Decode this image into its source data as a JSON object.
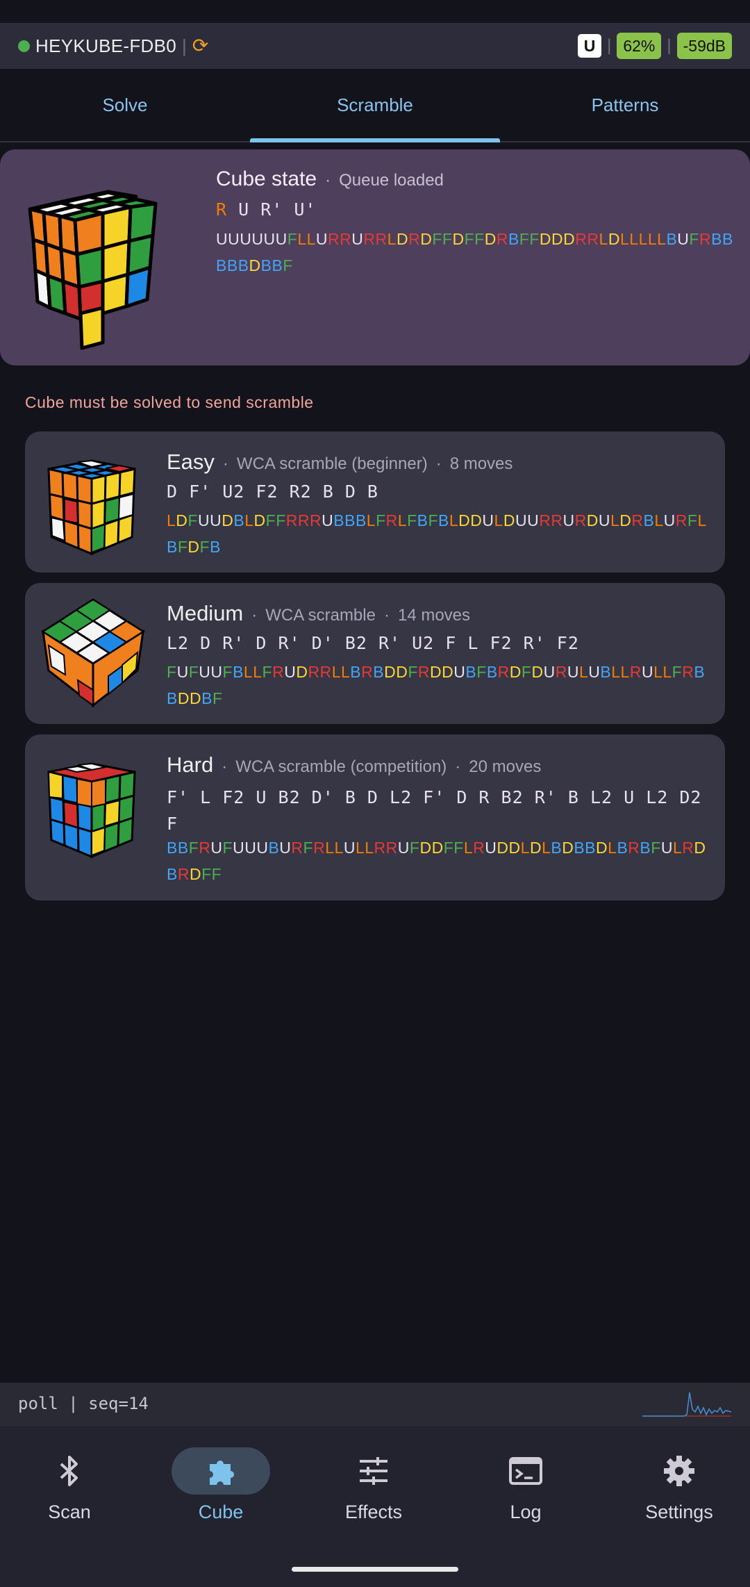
{
  "device": {
    "name": "HEYKUBE-FDB0",
    "badge_u": "U",
    "battery": "62%",
    "signal": "-59dB"
  },
  "tabs": [
    {
      "label": "Solve"
    },
    {
      "label": "Scramble"
    },
    {
      "label": "Patterns"
    }
  ],
  "cube_state": {
    "title": "Cube state",
    "status": "Queue loaded",
    "moves_first": "R",
    "moves_rest": " U R' U'",
    "facelets": "UUUUUUFLLURRURRLDRDFFDFFDRBFFDDDRRLDLLLLLBUFRBBBBBDBBF"
  },
  "warning": "Cube must be solved to send scramble",
  "scrambles": [
    {
      "title": "Easy",
      "kind": "WCA scramble (beginner)",
      "moves_count": "8 moves",
      "moves": "D F' U2 F2 R2 B D B",
      "facelets": "LDFUUDBLDFFRRRUBBBLFRLFBFBLDDULDUURRURDULDRBLURFLBFDFB"
    },
    {
      "title": "Medium",
      "kind": "WCA scramble",
      "moves_count": "14 moves",
      "moves": "L2 D R' D R' D' B2 R' U2 F L F2 R' F2",
      "facelets": "FUFUUFBLLFRUDRRLLBRBDDFRDDUBFBRDFDURULUBLLRULLFRBBDDBF"
    },
    {
      "title": "Hard",
      "kind": "WCA scramble (competition)",
      "moves_count": "20 moves",
      "moves": "F' L F2 U B2 D' B D L2 F' D R B2 R' B L2 U L2 D2 F",
      "facelets": "BBFRUFUUUBURFRLLULLRRUFDDFFLRUDDLDLBDBBDLBRBFULRDBRDFF"
    }
  ],
  "poll": {
    "text": "poll | seq=14"
  },
  "nav": [
    {
      "label": "Scan",
      "icon": "bluetooth-icon"
    },
    {
      "label": "Cube",
      "icon": "puzzle-icon"
    },
    {
      "label": "Effects",
      "icon": "sliders-icon"
    },
    {
      "label": "Log",
      "icon": "terminal-icon"
    },
    {
      "label": "Settings",
      "icon": "gear-icon"
    }
  ],
  "colors": {
    "U": "#e6e1ec",
    "F": "#4caf50",
    "L": "#f57c00",
    "R": "#e53935",
    "D": "#fdd835",
    "B": "#42a5f5",
    "accent": "#7ec3ec"
  }
}
